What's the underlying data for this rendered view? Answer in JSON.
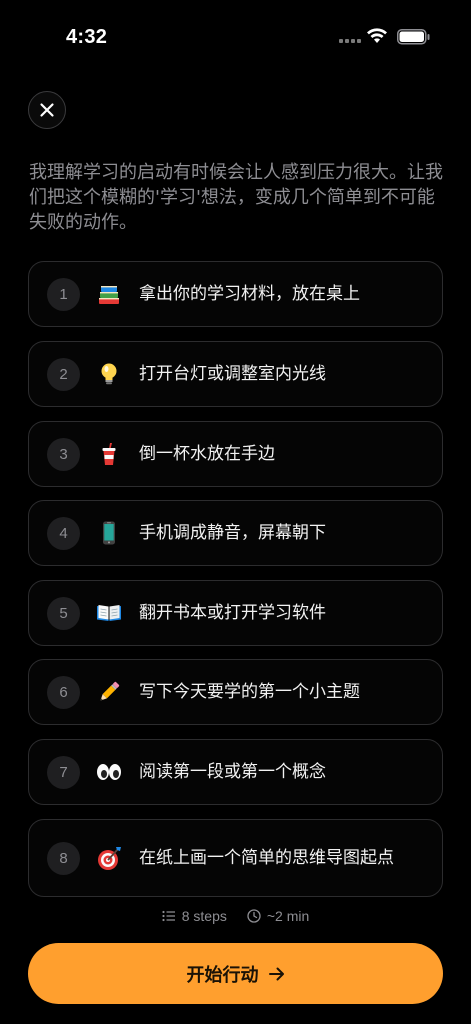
{
  "status_bar": {
    "time": "4:32"
  },
  "close_button": {
    "icon": "close-icon"
  },
  "intro_text": "我理解学习的启动有时候会让人感到压力很大。让我们把这个模糊的'学习'想法，变成几个简单到不可能失败的动作。",
  "steps": [
    {
      "number": "1",
      "emoji": "books-icon",
      "text": "拿出你的学习材料，放在桌上"
    },
    {
      "number": "2",
      "emoji": "lightbulb-icon",
      "text": "打开台灯或调整室内光线"
    },
    {
      "number": "3",
      "emoji": "cup-icon",
      "text": "倒一杯水放在手边"
    },
    {
      "number": "4",
      "emoji": "phone-icon",
      "text": "手机调成静音，屏幕朝下"
    },
    {
      "number": "5",
      "emoji": "open-book-icon",
      "text": "翻开书本或打开学习软件"
    },
    {
      "number": "6",
      "emoji": "pencil-icon",
      "text": "写下今天要学的第一个小主题"
    },
    {
      "number": "7",
      "emoji": "eyes-icon",
      "text": "阅读第一段或第一个概念"
    },
    {
      "number": "8",
      "emoji": "target-icon",
      "text": "在纸上画一个简单的思维导图起点"
    }
  ],
  "meta": {
    "steps_count": "8 steps",
    "duration": "~2 min"
  },
  "cta": {
    "label": "开始行动",
    "color": "#ff9f2e"
  }
}
